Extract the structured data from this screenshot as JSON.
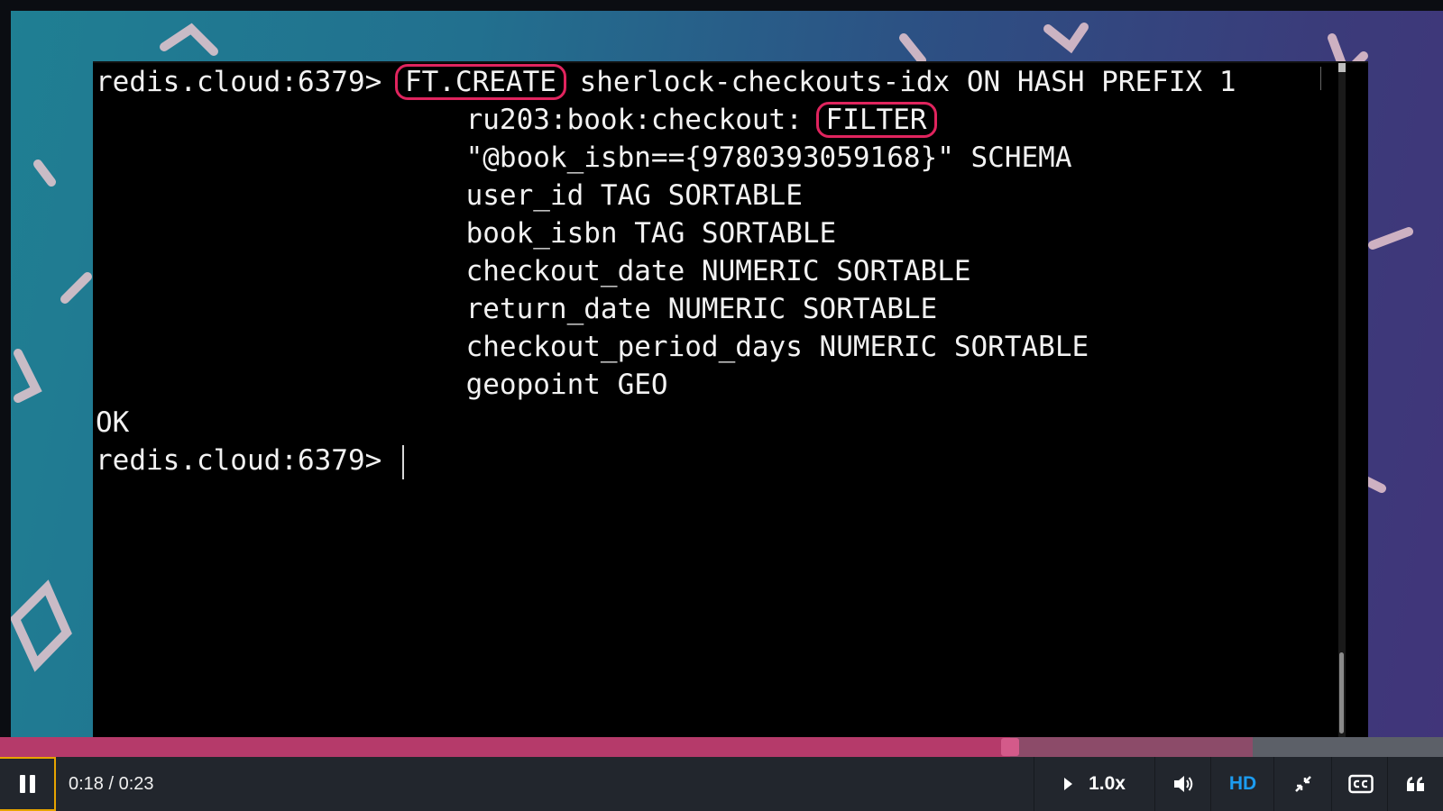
{
  "terminal": {
    "lines": [
      {
        "indent": "",
        "prompt": "redis.cloud:6379> ",
        "boxed": "FT.CREATE",
        "after": " sherlock-checkouts-idx ON HASH PREFIX 1"
      },
      {
        "indent": "                      ",
        "prompt": "",
        "pre": "ru203:book:checkout: ",
        "boxed": "FILTER"
      },
      {
        "indent": "                      ",
        "text": "\"@book_isbn=={9780393059168}\" SCHEMA"
      },
      {
        "indent": "                      ",
        "text": "user_id TAG SORTABLE"
      },
      {
        "indent": "                      ",
        "text": "book_isbn TAG SORTABLE"
      },
      {
        "indent": "                      ",
        "text": "checkout_date NUMERIC SORTABLE"
      },
      {
        "indent": "                      ",
        "text": "return_date NUMERIC SORTABLE"
      },
      {
        "indent": "                      ",
        "text": "checkout_period_days NUMERIC SORTABLE"
      },
      {
        "indent": "                      ",
        "text": "geopoint GEO"
      },
      {
        "indent": "",
        "text": "OK"
      },
      {
        "indent": "",
        "prompt": "redis.cloud:6379> ",
        "cursor": true
      }
    ],
    "highlight_color": "#e0245e"
  },
  "player": {
    "current_time": "0:18",
    "duration": "0:23",
    "time_display": "0:18 / 0:23",
    "played_fraction": 0.7,
    "buffered_fraction": 0.868,
    "speed_label": "1.0x",
    "quality_label": "HD",
    "accent_color": "#b53a6a",
    "icons": [
      "pause-icon",
      "play-triangle-icon",
      "volume-icon",
      "exit-fullscreen-icon",
      "closed-captions-icon",
      "quote-icon"
    ]
  }
}
